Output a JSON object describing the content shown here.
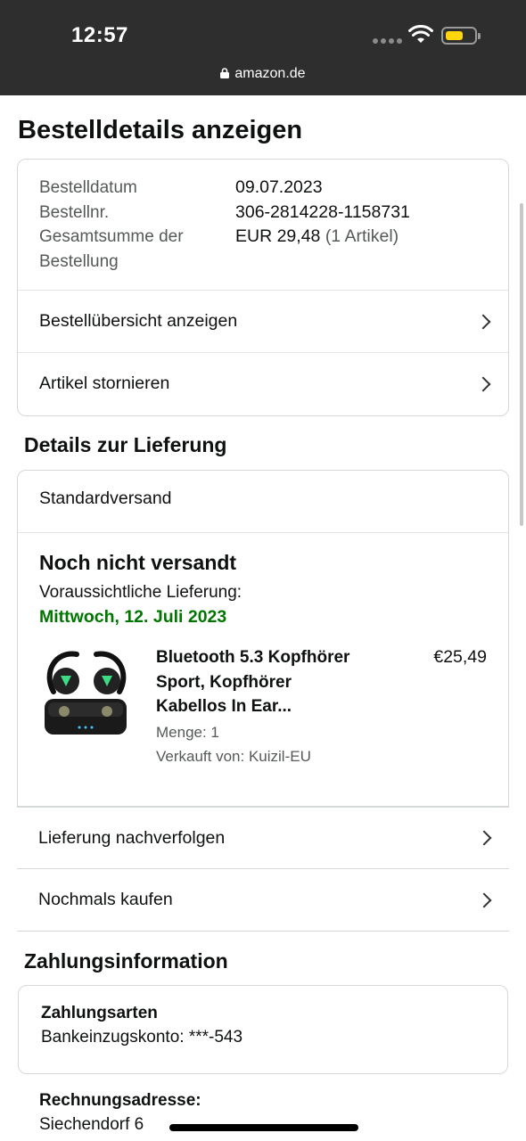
{
  "status_bar": {
    "time": "12:57",
    "url": "amazon.de"
  },
  "page": {
    "title": "Bestelldetails anzeigen"
  },
  "order_summary": {
    "date_label": "Bestelldatum",
    "date_value": "09.07.2023",
    "number_label": "Bestellnr.",
    "number_value": "306-2814228-1158731",
    "total_label_line1": "Gesamtsumme der",
    "total_label_line2": "Bestellung",
    "total_value": "EUR 29,48",
    "total_items": "(1 Artikel)",
    "links": [
      "Bestellübersicht anzeigen",
      "Artikel stornieren"
    ]
  },
  "delivery": {
    "section_title": "Details zur Lieferung",
    "method": "Standardversand",
    "status": "Noch nicht versandt",
    "eta_label": "Voraussichtliche Lieferung:",
    "eta_date": "Mittwoch, 12. Juli 2023",
    "product": {
      "title_line1": "Bluetooth 5.3 Kopfhörer",
      "title_line2": "Sport, Kopfhörer",
      "title_line3": "Kabellos In Ear...",
      "price": "€25,49",
      "quantity": "Menge: 1",
      "seller": "Verkauft von: Kuizil-EU"
    },
    "links": [
      "Lieferung nachverfolgen",
      "Nochmals kaufen"
    ]
  },
  "payment": {
    "section_title": "Zahlungsinformation",
    "methods_title": "Zahlungsarten",
    "methods_value": "Bankeinzugskonto: ***-543",
    "billing_title": "Rechnungsadresse:",
    "billing_value": "Siechendorf 6"
  },
  "colors": {
    "accent_green": "#007600",
    "topbar": "#2e2e2e",
    "battery": "#ffd60a"
  },
  "icons": [
    "lock-icon",
    "wifi-icon",
    "battery-icon",
    "chevron-right-icon"
  ]
}
